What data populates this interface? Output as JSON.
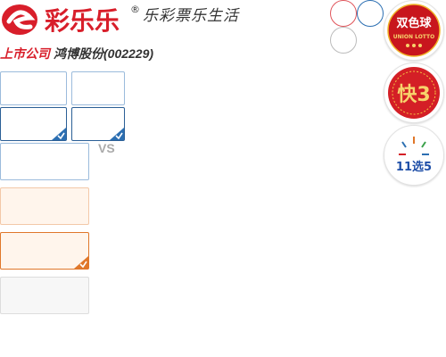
{
  "header": {
    "logo_text": "彩乐乐",
    "registered_mark": "®",
    "slogan": "乐彩票乐生活"
  },
  "company": {
    "tag": "上市公司",
    "name": "鸿博股份(002229)"
  },
  "matchup": {
    "vs_label": "VS"
  },
  "lottery_icons": [
    {
      "name": "双色球",
      "sub": "UNION LOTTO"
    },
    {
      "name": "快3"
    },
    {
      "name": "11选5"
    }
  ],
  "colors": {
    "brand_red": "#d81e2a",
    "brand_blue": "#2c6fb2",
    "accent_orange": "#e0772a"
  }
}
